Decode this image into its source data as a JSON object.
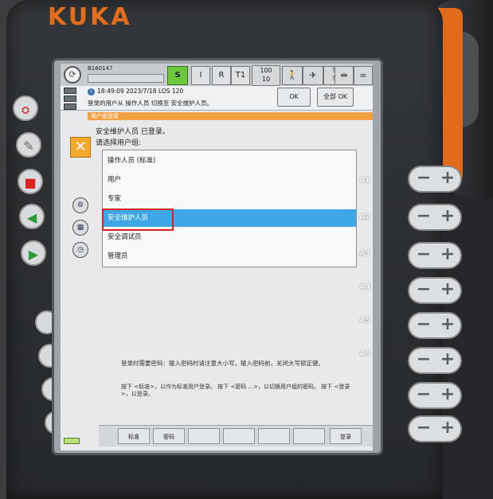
{
  "device": {
    "brand": "KUKA"
  },
  "statusbar": {
    "robot_name": "B160147",
    "mode_s": "S",
    "mode_i": "I",
    "mode_r": "R",
    "mode_t1": "T1",
    "speed_top": "100",
    "speed_bottom": "10",
    "icons": [
      "walk-icon",
      "tool-icon",
      "question-icon",
      "jog-icon",
      "infinity-icon"
    ]
  },
  "message": {
    "timestamp": "18:49:09 2023/7/18 LOS 120",
    "text": "登录的用户从 操作人员 切换至 安全维护人员。",
    "ok_label": "OK",
    "all_ok_label": "全部 OK"
  },
  "dialog": {
    "title": "用户组登录",
    "logged_in": "安全维护人员 已登录。",
    "select_label": "请选择用户组:",
    "items": [
      {
        "label": "操作人员 (标准)"
      },
      {
        "label": "用户"
      },
      {
        "label": "专家"
      },
      {
        "label": "安全维护人员"
      },
      {
        "label": "安全调试员"
      },
      {
        "label": "管理员"
      }
    ],
    "selected_index": 3,
    "hint_password": "登录时需要密码：输入密码时请注意大小写。输入密码前，关闭大写锁定键。",
    "hint_keys": "按下 <标准>，以作为标准用户登录。 按下 <密码 ...>，以切换用户组的密码。 按下 <登录>，以登录。"
  },
  "softkeys": {
    "standard": "标准",
    "password": "密码",
    "login": "登录"
  },
  "axes": [
    "A1",
    "A2",
    "A3",
    "A4",
    "A5",
    "A6"
  ],
  "colors": {
    "brand_orange": "#e36d1e",
    "selection_blue": "#3ea7e5",
    "highlight_red": "#d92020",
    "s_green": "#6cc73a"
  }
}
